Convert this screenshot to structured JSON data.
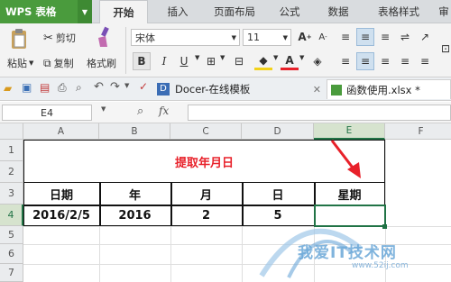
{
  "app": {
    "name": "WPS 表格"
  },
  "menu": {
    "tabs": [
      "开始",
      "插入",
      "页面布局",
      "公式",
      "数据",
      "表格样式",
      "审"
    ]
  },
  "ribbon": {
    "paste": "粘贴",
    "cut": "剪切",
    "copy": "复制",
    "format_painter": "格式刷",
    "font_name": "宋体",
    "font_size": "11",
    "bold": "B",
    "italic": "I",
    "underline": "U"
  },
  "doc_tabs": {
    "docer": "Docer-在线模板",
    "file": "函数使用.xlsx *"
  },
  "formula_bar": {
    "name_box": "E4",
    "fx": "fx",
    "formula": ""
  },
  "columns": [
    "A",
    "B",
    "C",
    "D",
    "E",
    "F"
  ],
  "rows": [
    "1",
    "2",
    "3",
    "4",
    "5",
    "6",
    "7"
  ],
  "sheet": {
    "title": "提取年月日",
    "headers": [
      "日期",
      "年",
      "月",
      "日",
      "星期"
    ],
    "row4": [
      "2016/2/5",
      "2016",
      "2",
      "5",
      ""
    ]
  },
  "watermark": {
    "text": "我爱IT技术网",
    "url": "www.52ij.com"
  },
  "colors": {
    "accent": "#4a9b3d",
    "title_red": "#e8212a",
    "selection": "#217346"
  }
}
